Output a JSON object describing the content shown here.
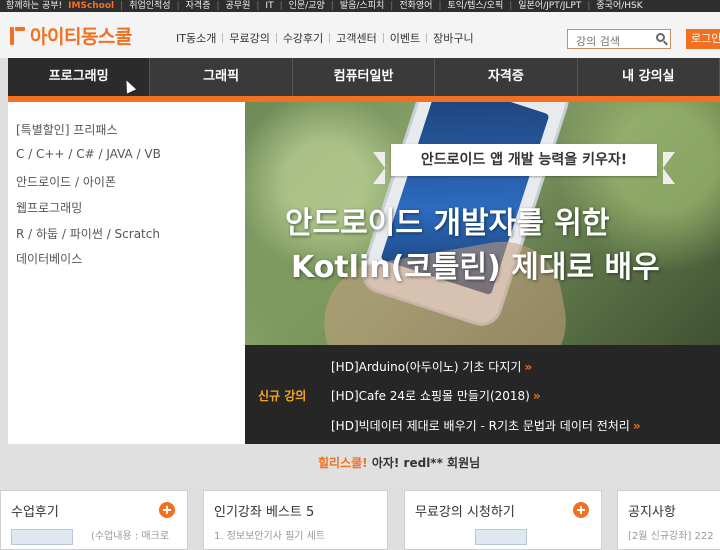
{
  "top_strip": {
    "lead": "함께하는 공부!",
    "brand": "IMSchool",
    "links": [
      "취업인적성",
      "자격증",
      "공무원",
      "IT",
      "인문/교양",
      "발음/스피치",
      "전화영어",
      "토익/텝스/오픽",
      "일본어/JPT/JLPT",
      "중국어/HSK"
    ]
  },
  "header": {
    "logo": "아이티동스쿨",
    "nav": [
      "IT동소개",
      "무료강의",
      "수강후기",
      "고객센터",
      "이벤트",
      "장바구니"
    ],
    "search_placeholder": "강의 검색",
    "login_label": "로그인"
  },
  "categories": [
    "프로그래밍",
    "그래픽",
    "컴퓨터일반",
    "자격증",
    "내 강의실"
  ],
  "dropdown": [
    "[특별할인] 프리패스",
    "C / C++ / C# / JAVA / VB",
    "안드로이드 / 아이폰",
    "웹프로그래밍",
    "R / 하둡 / 파이썬 / Scratch",
    "데이터베이스"
  ],
  "banner": {
    "ribbon": "안드로이드 앱 개발 능력을 키우자!",
    "title_line1": "안드로이드 개발자를 위한",
    "title_line2": "Kotlin(코틀린) 제대로 배우"
  },
  "new_courses": {
    "label": "신규 강의",
    "items": [
      "[HD]Arduino(아두이노) 기초 다지기",
      "[HD]Cafe 24로 쇼핑몰 만들기(2018)",
      "[HD]빅데이터 제대로 배우기 - R기초 문법과 데이터 전처리"
    ]
  },
  "greeting": {
    "prefix": "힐리스쿨!",
    "middle": " 아자! redl**",
    "suffix": " 회원님"
  },
  "bottom_boxes": [
    {
      "title": "수업후기",
      "sub": "(수업내용 : 매크로"
    },
    {
      "title": "인기강좌 베스트 5",
      "sub": "1. 정보보안기사 필기 세트"
    },
    {
      "title": "무료강의 시청하기",
      "sub": ""
    },
    {
      "title": "공지사항",
      "sub": "[2월 신규강좌] 222"
    }
  ],
  "colors": {
    "accent": "#f36f21",
    "dark": "#3a3a3a",
    "new_label": "#f5a623"
  }
}
